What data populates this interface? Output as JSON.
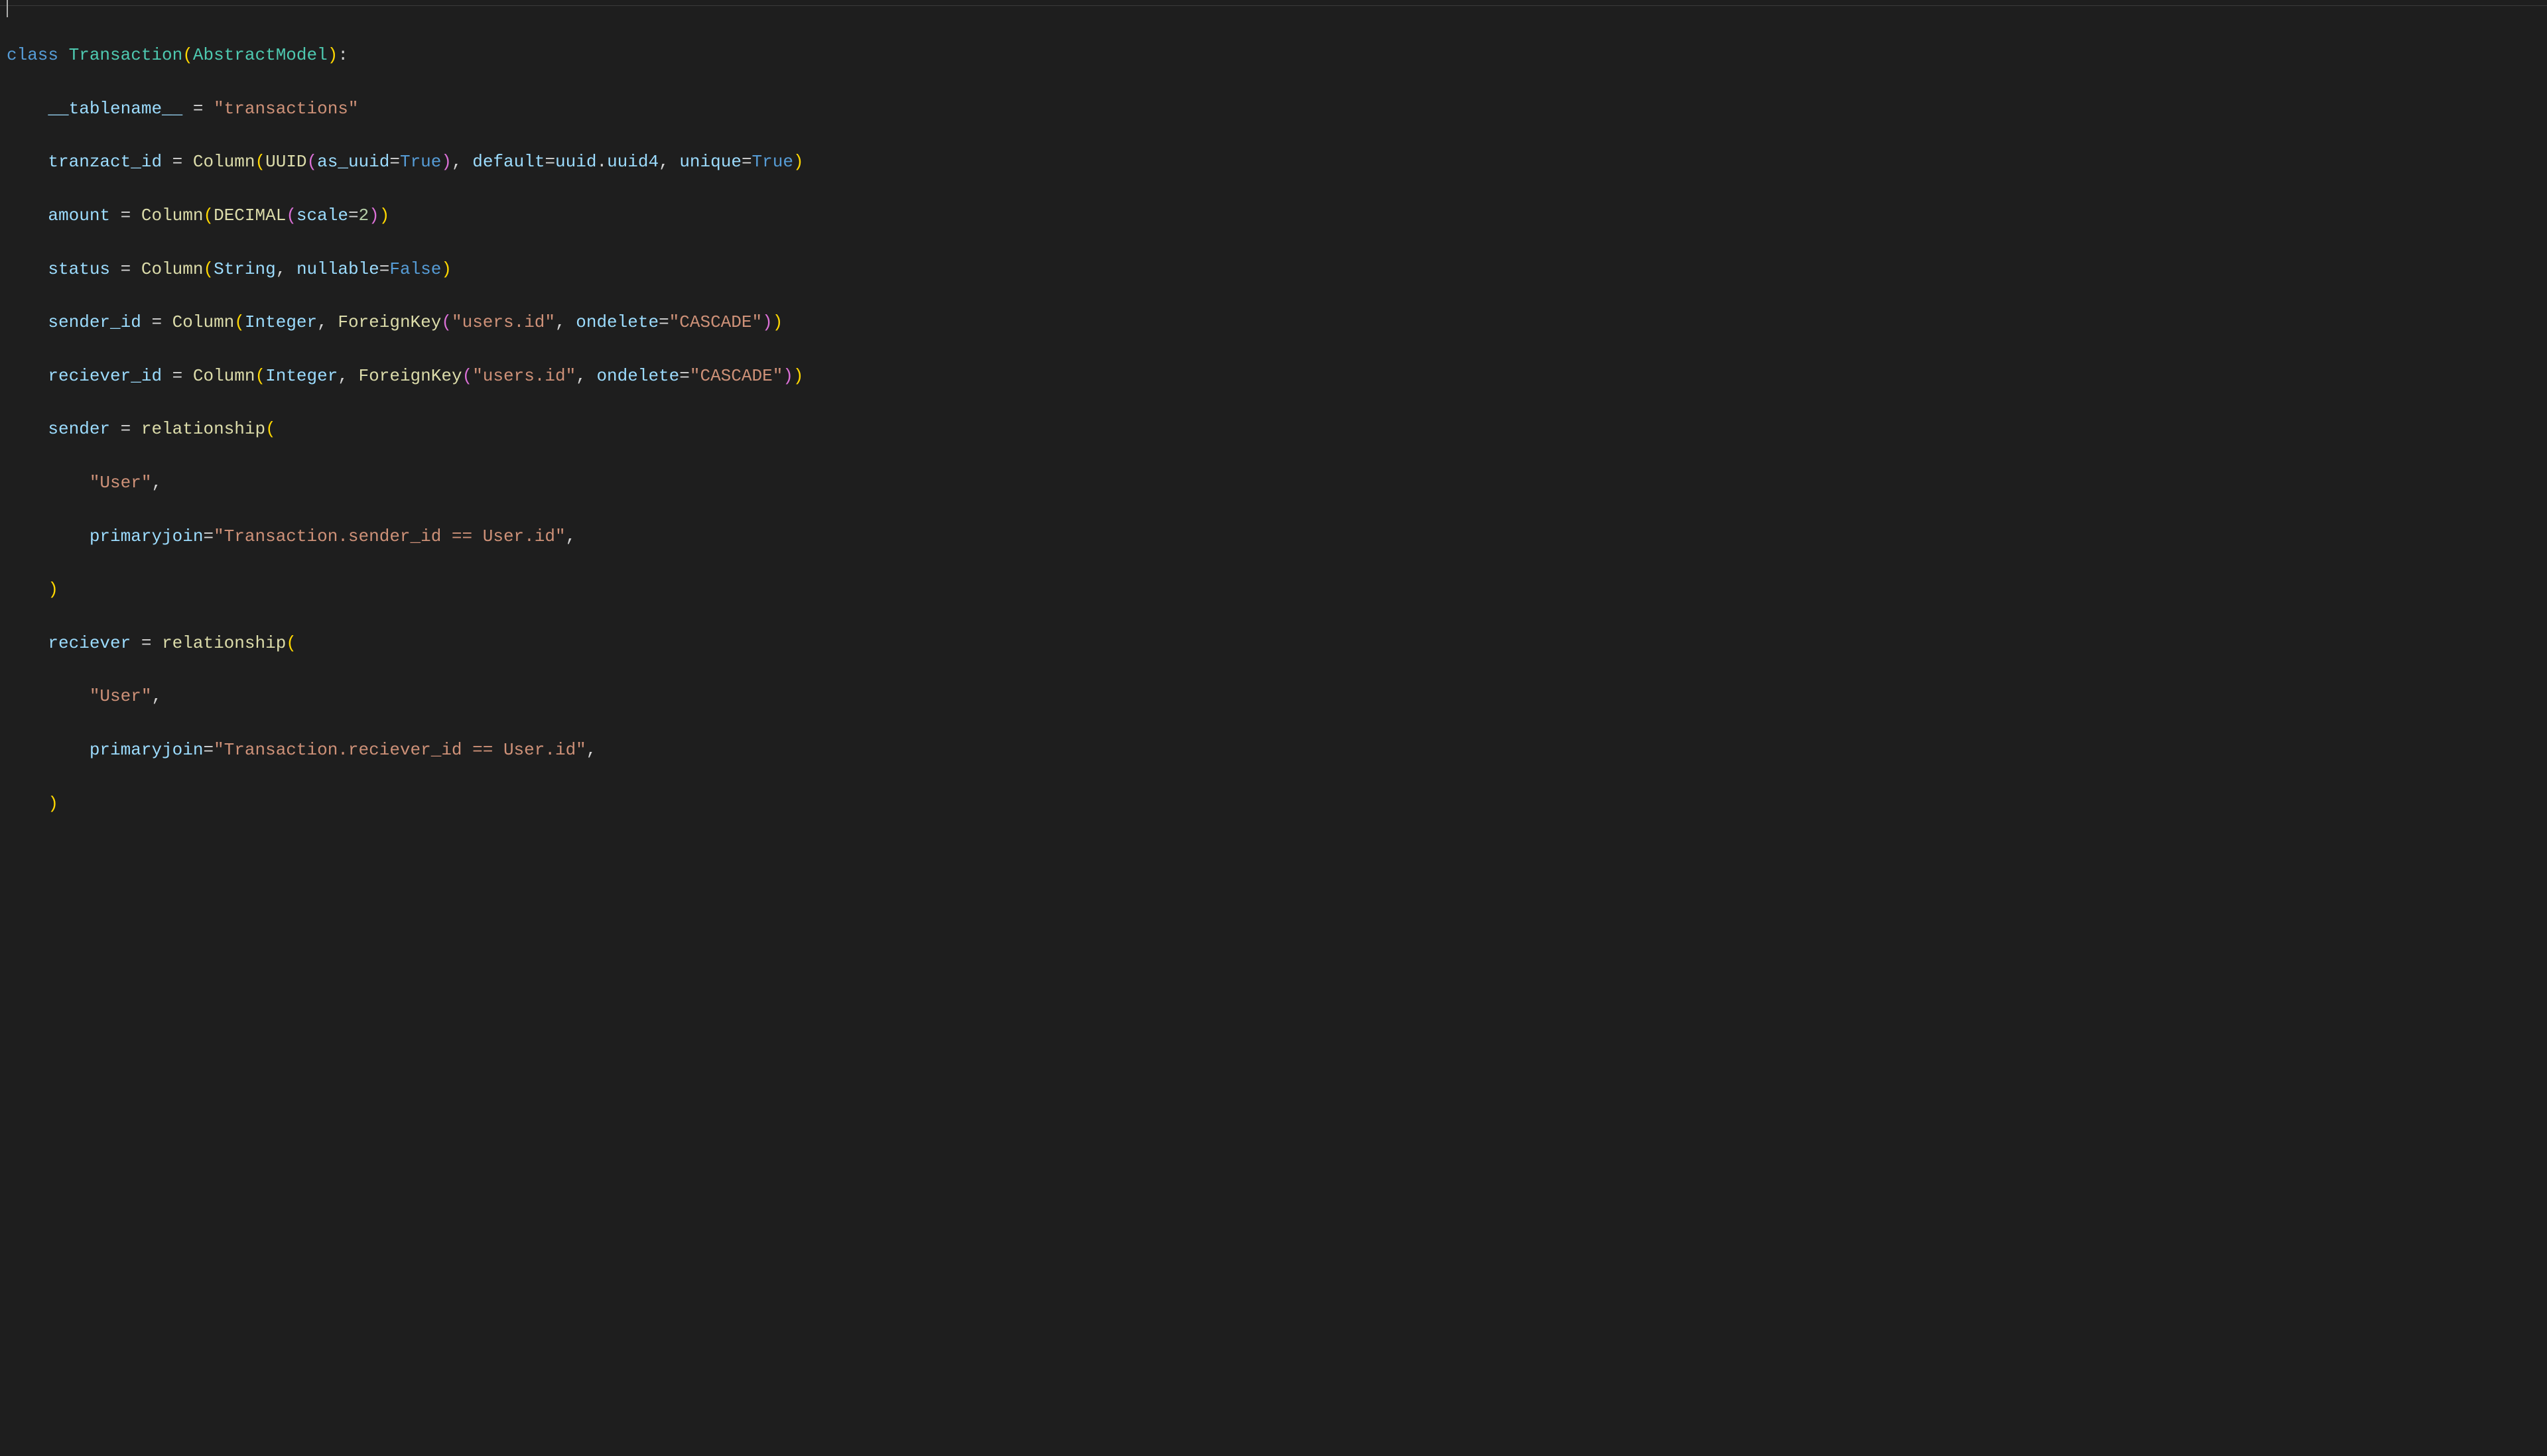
{
  "code": {
    "kw_class": "class",
    "cls_Transaction": "Transaction",
    "cls_AbstractModel": "AbstractModel",
    "var_tablename": "__tablename__",
    "str_transactions": "\"transactions\"",
    "var_tranzact_id": "tranzact_id",
    "fn_Column": "Column",
    "fn_UUID": "UUID",
    "var_as_uuid": "as_uuid",
    "const_True": "True",
    "var_default": "default",
    "var_uuid_mod": "uuid",
    "var_uuid4": "uuid4",
    "var_unique": "unique",
    "var_amount": "amount",
    "fn_DECIMAL": "DECIMAL",
    "var_scale": "scale",
    "num_2": "2",
    "var_status": "status",
    "var_String": "String",
    "var_nullable": "nullable",
    "const_False": "False",
    "var_sender_id": "sender_id",
    "var_Integer": "Integer",
    "fn_ForeignKey": "ForeignKey",
    "str_users_id": "\"users.id\"",
    "var_ondelete": "ondelete",
    "str_CASCADE": "\"CASCADE\"",
    "var_reciever_id": "reciever_id",
    "var_sender": "sender",
    "fn_relationship": "relationship",
    "str_User": "\"User\"",
    "var_primaryjoin": "primaryjoin",
    "str_pj_sender": "\"Transaction.sender_id == User.id\"",
    "var_reciever": "reciever",
    "str_pj_reciever": "\"Transaction.reciever_id == User.id\"",
    "eq": " = ",
    "eq_kw": "=",
    "colon": ":",
    "comma": ", ",
    "comma_trail": ",",
    "dot": ".",
    "lp_y": "(",
    "rp_y": ")",
    "lp_p": "(",
    "rp_p": ")",
    "lp_b": "(",
    "rp_b": ")"
  }
}
